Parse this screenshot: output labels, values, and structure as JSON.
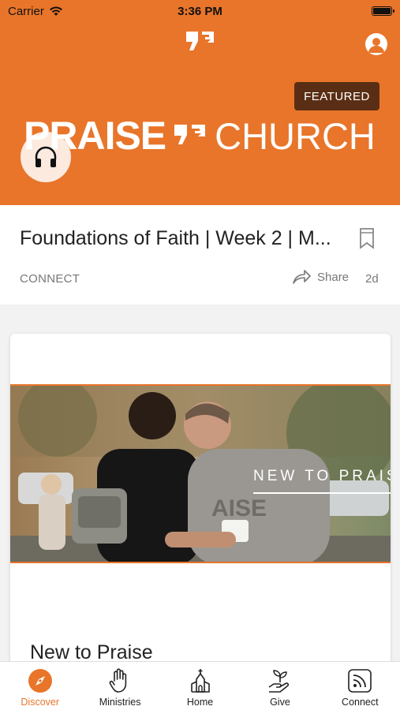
{
  "status_bar": {
    "carrier": "Carrier",
    "time": "3:36 PM"
  },
  "hero": {
    "badge": "FEATURED",
    "brand_left": "PRAISE",
    "brand_right": "CHURCH"
  },
  "sermon": {
    "title": "Foundations of Faith | Week 2 | M...",
    "category": "CONNECT",
    "share_label": "Share",
    "age": "2d"
  },
  "feature": {
    "photo_text": "NEW TO PRAISE",
    "title": "New to Praise"
  },
  "tabbar": {
    "items": [
      {
        "label": "Discover",
        "icon": "compass-icon",
        "active": true
      },
      {
        "label": "Ministries",
        "icon": "hand-icon",
        "active": false
      },
      {
        "label": "Home",
        "icon": "church-icon",
        "active": false
      },
      {
        "label": "Give",
        "icon": "plant-hand-icon",
        "active": false
      },
      {
        "label": "Connect",
        "icon": "rss-icon",
        "active": false
      }
    ]
  },
  "colors": {
    "accent": "#e8752a",
    "badge_bg": "#5a2e14"
  }
}
